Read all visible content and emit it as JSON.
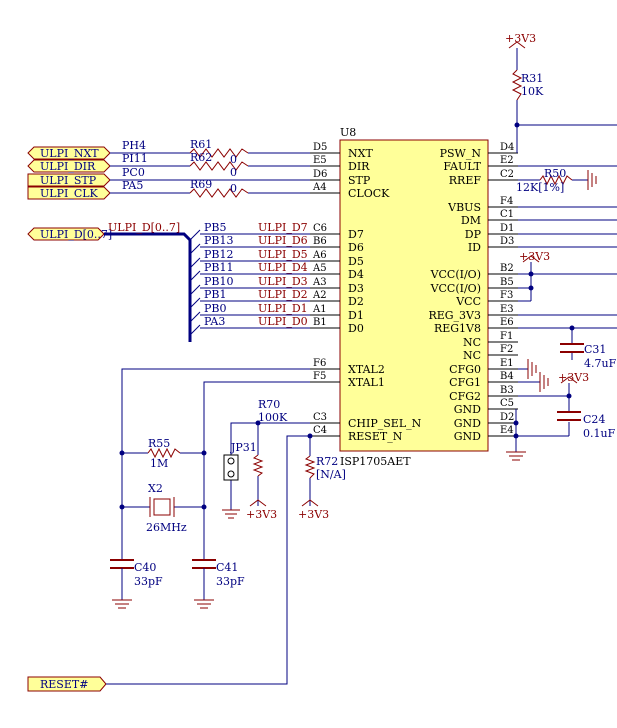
{
  "chip": {
    "refdes": "U8",
    "part": "ISP1705AET",
    "left_pins": [
      {
        "num": "D5",
        "name": "NXT"
      },
      {
        "num": "E5",
        "name": "DIR"
      },
      {
        "num": "D6",
        "name": "STP"
      },
      {
        "num": "A4",
        "name": "CLOCK"
      },
      {
        "num": "C6",
        "name": "D7"
      },
      {
        "num": "B6",
        "name": "D6"
      },
      {
        "num": "A6",
        "name": "D5"
      },
      {
        "num": "A5",
        "name": "D4"
      },
      {
        "num": "A3",
        "name": "D3"
      },
      {
        "num": "A2",
        "name": "D2"
      },
      {
        "num": "A1",
        "name": "D1"
      },
      {
        "num": "B1",
        "name": "D0"
      },
      {
        "num": "F6",
        "name": "XTAL2"
      },
      {
        "num": "F5",
        "name": "XTAL1"
      },
      {
        "num": "C3",
        "name": "CHIP_SEL_N"
      },
      {
        "num": "C4",
        "name": "RESET_N"
      }
    ],
    "right_pins": [
      {
        "num": "D4",
        "name": "PSW_N"
      },
      {
        "num": "E2",
        "name": "FAULT"
      },
      {
        "num": "C2",
        "name": "RREF"
      },
      {
        "num": "F4",
        "name": "VBUS"
      },
      {
        "num": "C1",
        "name": "DM"
      },
      {
        "num": "D1",
        "name": "DP"
      },
      {
        "num": "D3",
        "name": "ID"
      },
      {
        "num": "B2",
        "name": "VCC(I/O)"
      },
      {
        "num": "B5",
        "name": "VCC(I/O)"
      },
      {
        "num": "F3",
        "name": "VCC"
      },
      {
        "num": "E3",
        "name": "REG_3V3"
      },
      {
        "num": "E6",
        "name": "REG1V8"
      },
      {
        "num": "F1",
        "name": "NC"
      },
      {
        "num": "F2",
        "name": "NC"
      },
      {
        "num": "E1",
        "name": "CFG0"
      },
      {
        "num": "B4",
        "name": "CFG1"
      },
      {
        "num": "B3",
        "name": "CFG2"
      },
      {
        "num": "C5",
        "name": "GND"
      },
      {
        "num": "D2",
        "name": "GND"
      },
      {
        "num": "E4",
        "name": "GND"
      }
    ]
  },
  "ports": {
    "ulpi_nxt": "ULPI_NXT",
    "ulpi_dir": "ULPI_DIR",
    "ulpi_stp": "ULPI_STP",
    "ulpi_clk": "ULPI_CLK",
    "ulpi_d": "ULPI_D[0..7]",
    "reset": "RESET#"
  },
  "bus_label": "ULPI_D[0..7]",
  "mcu_pins": {
    "ctrl": [
      "PH4",
      "PI11",
      "PC0",
      "PA5"
    ],
    "data": [
      "PB5",
      "PB13",
      "PB12",
      "PB11",
      "PB10",
      "PB1",
      "PB0",
      "PA3"
    ]
  },
  "data_nets": [
    "ULPI_D7",
    "ULPI_D6",
    "ULPI_D5",
    "ULPI_D4",
    "ULPI_D3",
    "ULPI_D2",
    "ULPI_D1",
    "ULPI_D0"
  ],
  "series_resistors": [
    {
      "ref": "R61",
      "value": "0"
    },
    {
      "ref": "R62",
      "value": "0"
    },
    {
      "ref": "R69",
      "value": "0"
    }
  ],
  "components": {
    "r31": {
      "ref": "R31",
      "value": "10K"
    },
    "r50": {
      "ref": "R50",
      "value": "12K[1%]"
    },
    "r55": {
      "ref": "R55",
      "value": "1M"
    },
    "r70": {
      "ref": "R70",
      "value": "100K"
    },
    "r72": {
      "ref": "R72",
      "value": "[N/A]"
    },
    "x2": {
      "ref": "X2",
      "value": "26MHz"
    },
    "c40": {
      "ref": "C40",
      "value": "33pF"
    },
    "c41": {
      "ref": "C41",
      "value": "33pF"
    },
    "c31": {
      "ref": "C31",
      "value": "4.7uF"
    },
    "c24": {
      "ref": "C24",
      "value": "0.1uF"
    },
    "jp31": {
      "ref": "JP31"
    }
  },
  "power": {
    "v3": "+3V3"
  }
}
